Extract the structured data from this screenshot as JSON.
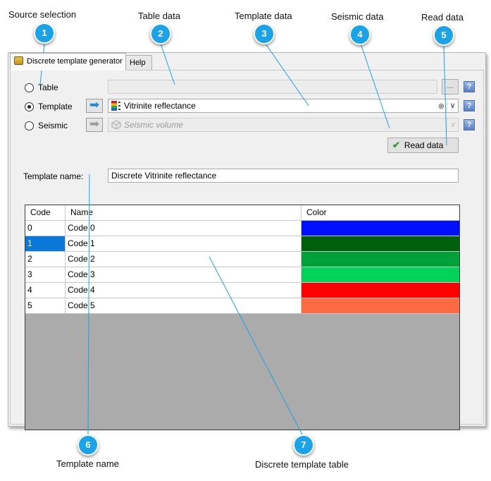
{
  "callouts": [
    {
      "number": "1",
      "label": "Source selection"
    },
    {
      "number": "2",
      "label": "Table data"
    },
    {
      "number": "3",
      "label": "Template data"
    },
    {
      "number": "4",
      "label": "Seismic data"
    },
    {
      "number": "5",
      "label": "Read data"
    },
    {
      "number": "6",
      "label": "Template name"
    },
    {
      "number": "7",
      "label": "Discrete template table"
    }
  ],
  "tabs": [
    {
      "label": "Discrete template generator",
      "active": true,
      "icon": "template-generator-icon"
    },
    {
      "label": "Help",
      "active": false
    }
  ],
  "source": {
    "table_label": "Table",
    "template_label": "Template",
    "seismic_label": "Seismic",
    "selected": "Template",
    "table_value": "",
    "browse_label": "...",
    "template_value": "Vitrinite reflectance",
    "template_icon": "discrete-template-icon",
    "seismic_value": "Seismic volume",
    "seismic_icon": "seismic-cube-icon",
    "help_label": "?",
    "clear_icon": "clear-icon",
    "dropdown_icon": "chevron-down-icon",
    "arrow_icon": "arrow-right-icon"
  },
  "read_button": {
    "label": "Read data",
    "icon": "checkmark-icon"
  },
  "template_name": {
    "label": "Template name:",
    "value": "Discrete Vitrinite reflectance"
  },
  "table": {
    "headers": {
      "code": "Code",
      "name": "Name",
      "color": "Color"
    },
    "rows": [
      {
        "code": "0",
        "name": "Code 0",
        "color": "#0010ff"
      },
      {
        "code": "1",
        "name": "Code 1",
        "color": "#005f0a"
      },
      {
        "code": "2",
        "name": "Code 2",
        "color": "#00a13a"
      },
      {
        "code": "3",
        "name": "Code 3",
        "color": "#00d35a"
      },
      {
        "code": "4",
        "name": "Code 4",
        "color": "#ff0000"
      },
      {
        "code": "5",
        "name": "Code 5",
        "color": "#ff6a42"
      }
    ],
    "selected_row": 1
  },
  "colors": {
    "accent": "#1aa3e8",
    "selection": "#0a78d7",
    "empty_grid": "#ababab"
  }
}
